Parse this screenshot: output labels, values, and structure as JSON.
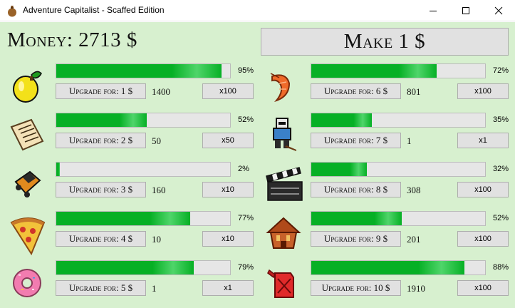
{
  "window": {
    "title": "Adventure Capitalist - Scaffed Edition"
  },
  "header": {
    "money": "Money: 2713 $",
    "make_button": "Make 1 $"
  },
  "businesses": [
    {
      "name": "lemon",
      "progress": 95,
      "progress_label": "95%",
      "upgrade": "Upgrade for: 1 $",
      "count": "1400",
      "multiplier": "x100"
    },
    {
      "name": "newspaper",
      "progress": 52,
      "progress_label": "52%",
      "upgrade": "Upgrade for: 2 $",
      "count": "50",
      "multiplier": "x50"
    },
    {
      "name": "car-wash",
      "progress": 2,
      "progress_label": "2%",
      "upgrade": "Upgrade for: 3 $",
      "count": "160",
      "multiplier": "x10"
    },
    {
      "name": "pizza",
      "progress": 77,
      "progress_label": "77%",
      "upgrade": "Upgrade for: 4 $",
      "count": "10",
      "multiplier": "x10"
    },
    {
      "name": "donut",
      "progress": 79,
      "progress_label": "79%",
      "upgrade": "Upgrade for: 5 $",
      "count": "1",
      "multiplier": "x1"
    },
    {
      "name": "shrimp",
      "progress": 72,
      "progress_label": "72%",
      "upgrade": "Upgrade for: 6 $",
      "count": "801",
      "multiplier": "x100"
    },
    {
      "name": "hockey",
      "progress": 35,
      "progress_label": "35%",
      "upgrade": "Upgrade for: 7 $",
      "count": "1",
      "multiplier": "x1"
    },
    {
      "name": "movie",
      "progress": 32,
      "progress_label": "32%",
      "upgrade": "Upgrade for: 8 $",
      "count": "308",
      "multiplier": "x100"
    },
    {
      "name": "bank",
      "progress": 52,
      "progress_label": "52%",
      "upgrade": "Upgrade for: 9 $",
      "count": "201",
      "multiplier": "x100"
    },
    {
      "name": "oil",
      "progress": 88,
      "progress_label": "88%",
      "upgrade": "Upgrade for: 10 $",
      "count": "1910",
      "multiplier": "x100"
    }
  ],
  "colors": {
    "background": "#d7f0cf",
    "progress_fill": "#06b025",
    "button": "#e1e1e1"
  }
}
